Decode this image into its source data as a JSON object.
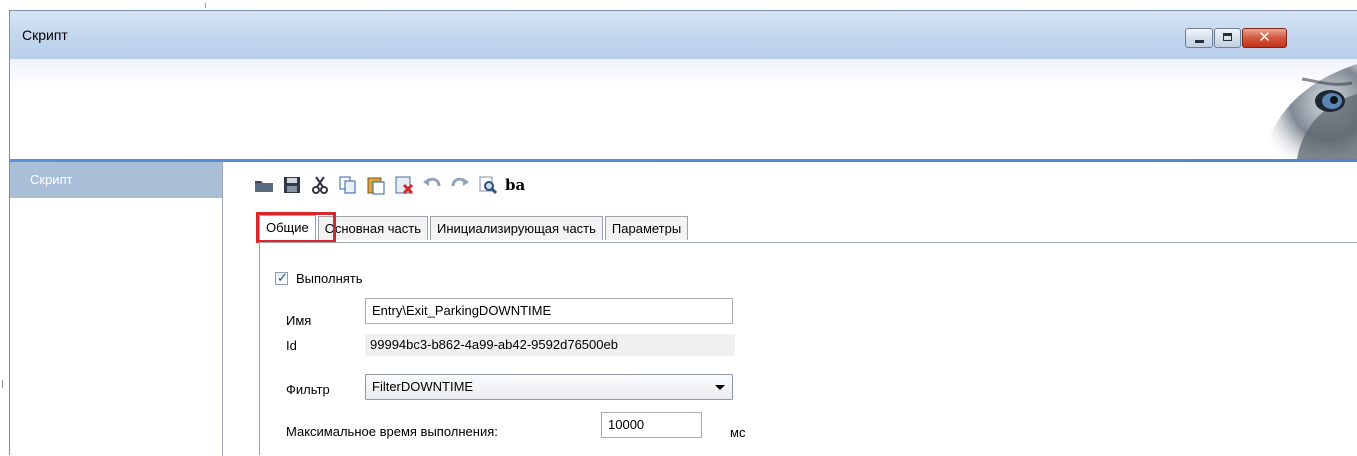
{
  "window": {
    "title": "Скрипт",
    "controls": [
      "minimize-icon",
      "maximize-icon",
      "close-icon"
    ],
    "close_glyph": "✕"
  },
  "sidebar": {
    "items": [
      {
        "label": "Скрипт",
        "selected": true
      }
    ]
  },
  "toolbar": {
    "icons": [
      "open-folder-icon",
      "save-icon",
      "cut-icon",
      "copy-icon",
      "paste-icon",
      "delete-icon",
      "undo-icon",
      "redo-icon",
      "find-icon",
      "text-format-icon"
    ],
    "text_format_glyph": "ba"
  },
  "tabs": [
    {
      "label": "Общие",
      "active": true
    },
    {
      "label": "Основная часть",
      "active": false
    },
    {
      "label": "Инициализирующая часть",
      "active": false
    },
    {
      "label": "Параметры",
      "active": false
    }
  ],
  "general": {
    "execute_label": "Выполнять",
    "execute_checked": true,
    "check_glyph": "✓",
    "name_label": "Имя",
    "name_value": "Entry\\Exit_ParkingDOWNTIME",
    "id_label": "Id",
    "id_value": "99994bc3-b862-4a99-ab42-9592d76500eb",
    "filter_label": "Фильтр",
    "filter_value": "FilterDOWNTIME",
    "max_time_label": "Максимальное время выполнения:",
    "max_time_value": "10000",
    "max_time_unit": "мс"
  },
  "colors": {
    "accent": "#4f86d4",
    "sidebar_selected": "#a9bfd8",
    "highlight": "#d9262d"
  }
}
